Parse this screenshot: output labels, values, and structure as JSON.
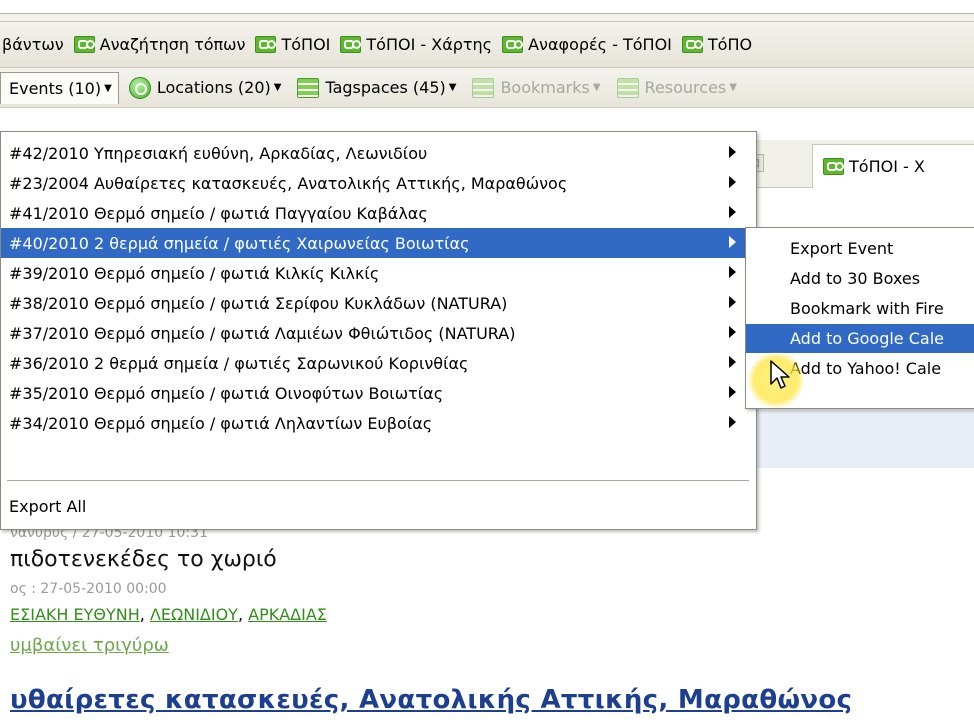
{
  "bookmarks_toolbar": {
    "items": [
      {
        "label": "βάντων",
        "has_icon": false
      },
      {
        "label": "Αναζήτηση τόπων",
        "has_icon": true
      },
      {
        "label": "ΤόΠΟΙ",
        "has_icon": true
      },
      {
        "label": "ΤόΠΟΙ - Χάρτης",
        "has_icon": true
      },
      {
        "label": "Αναφορές - ΤόΠΟΙ",
        "has_icon": true
      },
      {
        "label": "ΤόΠΟ",
        "has_icon": true
      }
    ]
  },
  "menu_toolbar": {
    "events": "Events (10)",
    "locations": "Locations (20)",
    "tagspaces": "Tagspaces (45)",
    "bookmarks": "Bookmarks",
    "resources": "Resources"
  },
  "events_menu": {
    "items": [
      "#42/2010  Υπηρεσιακή ευθύνη, Αρκαδίας, Λεωνιδίου",
      "#23/2004  Αυθαίρετες κατασκευές, Ανατολικής Αττικής, Μαραθώνος",
      "#41/2010  Θερμό σημείο / φωτιά Παγγαίου Καβάλας",
      "#40/2010  2 θερμά σημεία / φωτιές Χαιρωνείας Βοιωτίας",
      "#39/2010  Θερμό σημείο / φωτιά Κιλκίς Κιλκίς",
      "#38/2010  Θερμό σημείο / φωτιά Σερίφου Κυκλάδων (NATURA)",
      "#37/2010  Θερμό σημείο / φωτιά Λαμιέων Φθιώτιδος (NATURA)",
      "#36/2010  2 θερμά σημεία / φωτιές Σαρωνικού Κορινθίας",
      "#35/2010  Θερμό σημείο / φωτιά Οινοφύτων Βοιωτίας",
      "#34/2010  Θερμό σημείο / φωτιά Ληλαντίων Ευβοίας"
    ],
    "highlighted_index": 3,
    "export_all": "Export All"
  },
  "submenu": {
    "items": [
      "Export Event",
      "Add to 30 Boxes",
      "Bookmark with Fire",
      "Add to Google Cale",
      "Add to Yahoo! Cale"
    ],
    "highlighted_index": 3
  },
  "page_tabs": {
    "close_symbol": "⊠",
    "active_tab": "ΤόΠΟΙ - Χ"
  },
  "content": {
    "meta1": "νανυρυς / 27-05-2010 10:31",
    "title1": "πιδοτενεκέδες το χωριό",
    "meta2": "ος : 27-05-2010 00:00",
    "tags": [
      "ΕΣΙΑΚΗ ΕΥΘΥΝΗ",
      "ΛΕΩΝΙΔΙΟΥ",
      "ΑΡΚΑΔΙΑΣ"
    ],
    "tag_sep": ",",
    "link1": "υμβαίνει τριγύρω",
    "heading2": "υθαίρετες κατασκευές, Ανατολικής Αττικής, Μαραθώνος"
  },
  "colors": {
    "menu_highlight": "#316ac5",
    "brand_green": "#5cb82d",
    "link_blue": "#1d3f92",
    "tag_green": "#2f8f1a"
  }
}
